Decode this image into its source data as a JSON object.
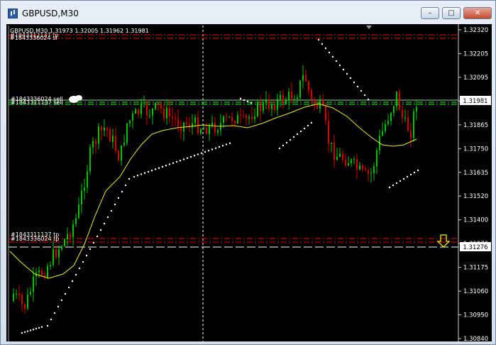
{
  "window": {
    "title": "GBPUSD,M30",
    "buttons": {
      "minimize": "–",
      "maximize": "□",
      "close": "✕"
    }
  },
  "chart": {
    "ohlc_text": "GBPUSD,M30  1.31973 1.32005 1.31962 1.31981",
    "overlapped_label": "#1843312137 tp",
    "order_labels": {
      "top_left": "#1843336024 sl",
      "sell": "#1843336024 sell",
      "sell_overlap": "#1843311137 sell",
      "low_a": "#1843311137 tp",
      "low_b": "#1843336024 tp"
    },
    "price_axis": [
      "1.32320",
      "1.32205",
      "1.32095",
      "1.31981",
      "1.31865",
      "1.31750",
      "1.31635",
      "1.31520",
      "1.31400",
      "1.31276",
      "1.31175",
      "1.31060",
      "1.30950",
      "1.30840"
    ],
    "current_price": "1.31981",
    "tp_price": "1.31276",
    "colors": {
      "bull": "#00c800",
      "bear": "#e00000",
      "ma": "#f0f000",
      "sar": "#ffffff",
      "sell_line": "#00ff00",
      "stop_line": "#ff0000",
      "price_line": "#ffffff"
    }
  }
}
